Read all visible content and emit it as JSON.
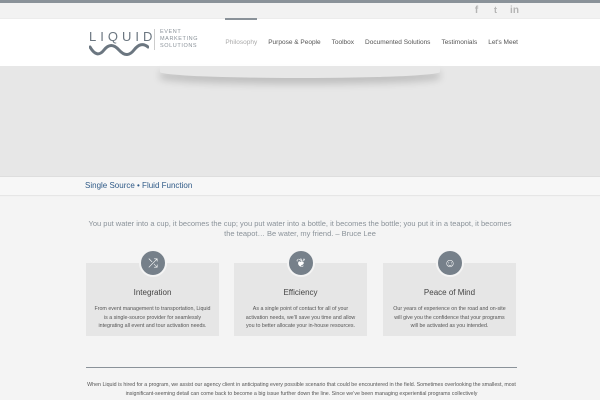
{
  "social": {
    "icons": [
      "facebook-icon",
      "twitter-icon",
      "linkedin-icon"
    ],
    "facebook_glyph": "f",
    "twitter_glyph": "t",
    "linkedin_glyph": "in"
  },
  "logo": {
    "word": "LIQUID",
    "tagline": [
      "EVENT",
      "MARKETING",
      "SOLUTIONS"
    ]
  },
  "nav": {
    "items": [
      {
        "label": "Philosophy",
        "active": true
      },
      {
        "label": "Purpose & People",
        "active": false
      },
      {
        "label": "Toolbox",
        "active": false
      },
      {
        "label": "Documented Solutions",
        "active": false
      },
      {
        "label": "Testimonials",
        "active": false
      },
      {
        "label": "Let's Meet",
        "active": false
      }
    ]
  },
  "page": {
    "title": "Single Source • Fluid Function",
    "quote": "You put water into a cup, it becomes the cup; you put water into a bottle, it becomes the bottle; you put it in a teapot, it becomes the teapot… Be water, my friend. – Bruce Lee"
  },
  "cards": [
    {
      "icon": "shuffle-icon",
      "glyph": "⤮",
      "title": "Integration",
      "text": "From event management to transportation, Liquid is a single-source provider for seamlessly integrating all event and tour activation needs."
    },
    {
      "icon": "leaf-icon",
      "glyph": "❦",
      "title": "Efficiency",
      "text": "As a single point of contact for all of your activation needs, we’ll save you time and allow you to better allocate your in-house resources."
    },
    {
      "icon": "smile-icon",
      "glyph": "☺",
      "title": "Peace of Mind",
      "text": "Our years of experience on the road and on-site will give you the confidence that your programs will be activated as you intended."
    }
  ],
  "body_text": "When Liquid is hired for a program, we assist our agency client in anticipating every possible scenario that could be encountered in the field. Sometimes overlooking the smallest, most insignificant-seeming detail can come back to become a big issue further down the line. Since we’ve been managing experiential programs collectively",
  "colors": {
    "accent": "#8a9299",
    "title_blue": "#2f5a87",
    "card_bg": "#e6e6e6",
    "icon_circle": "#76808a"
  }
}
